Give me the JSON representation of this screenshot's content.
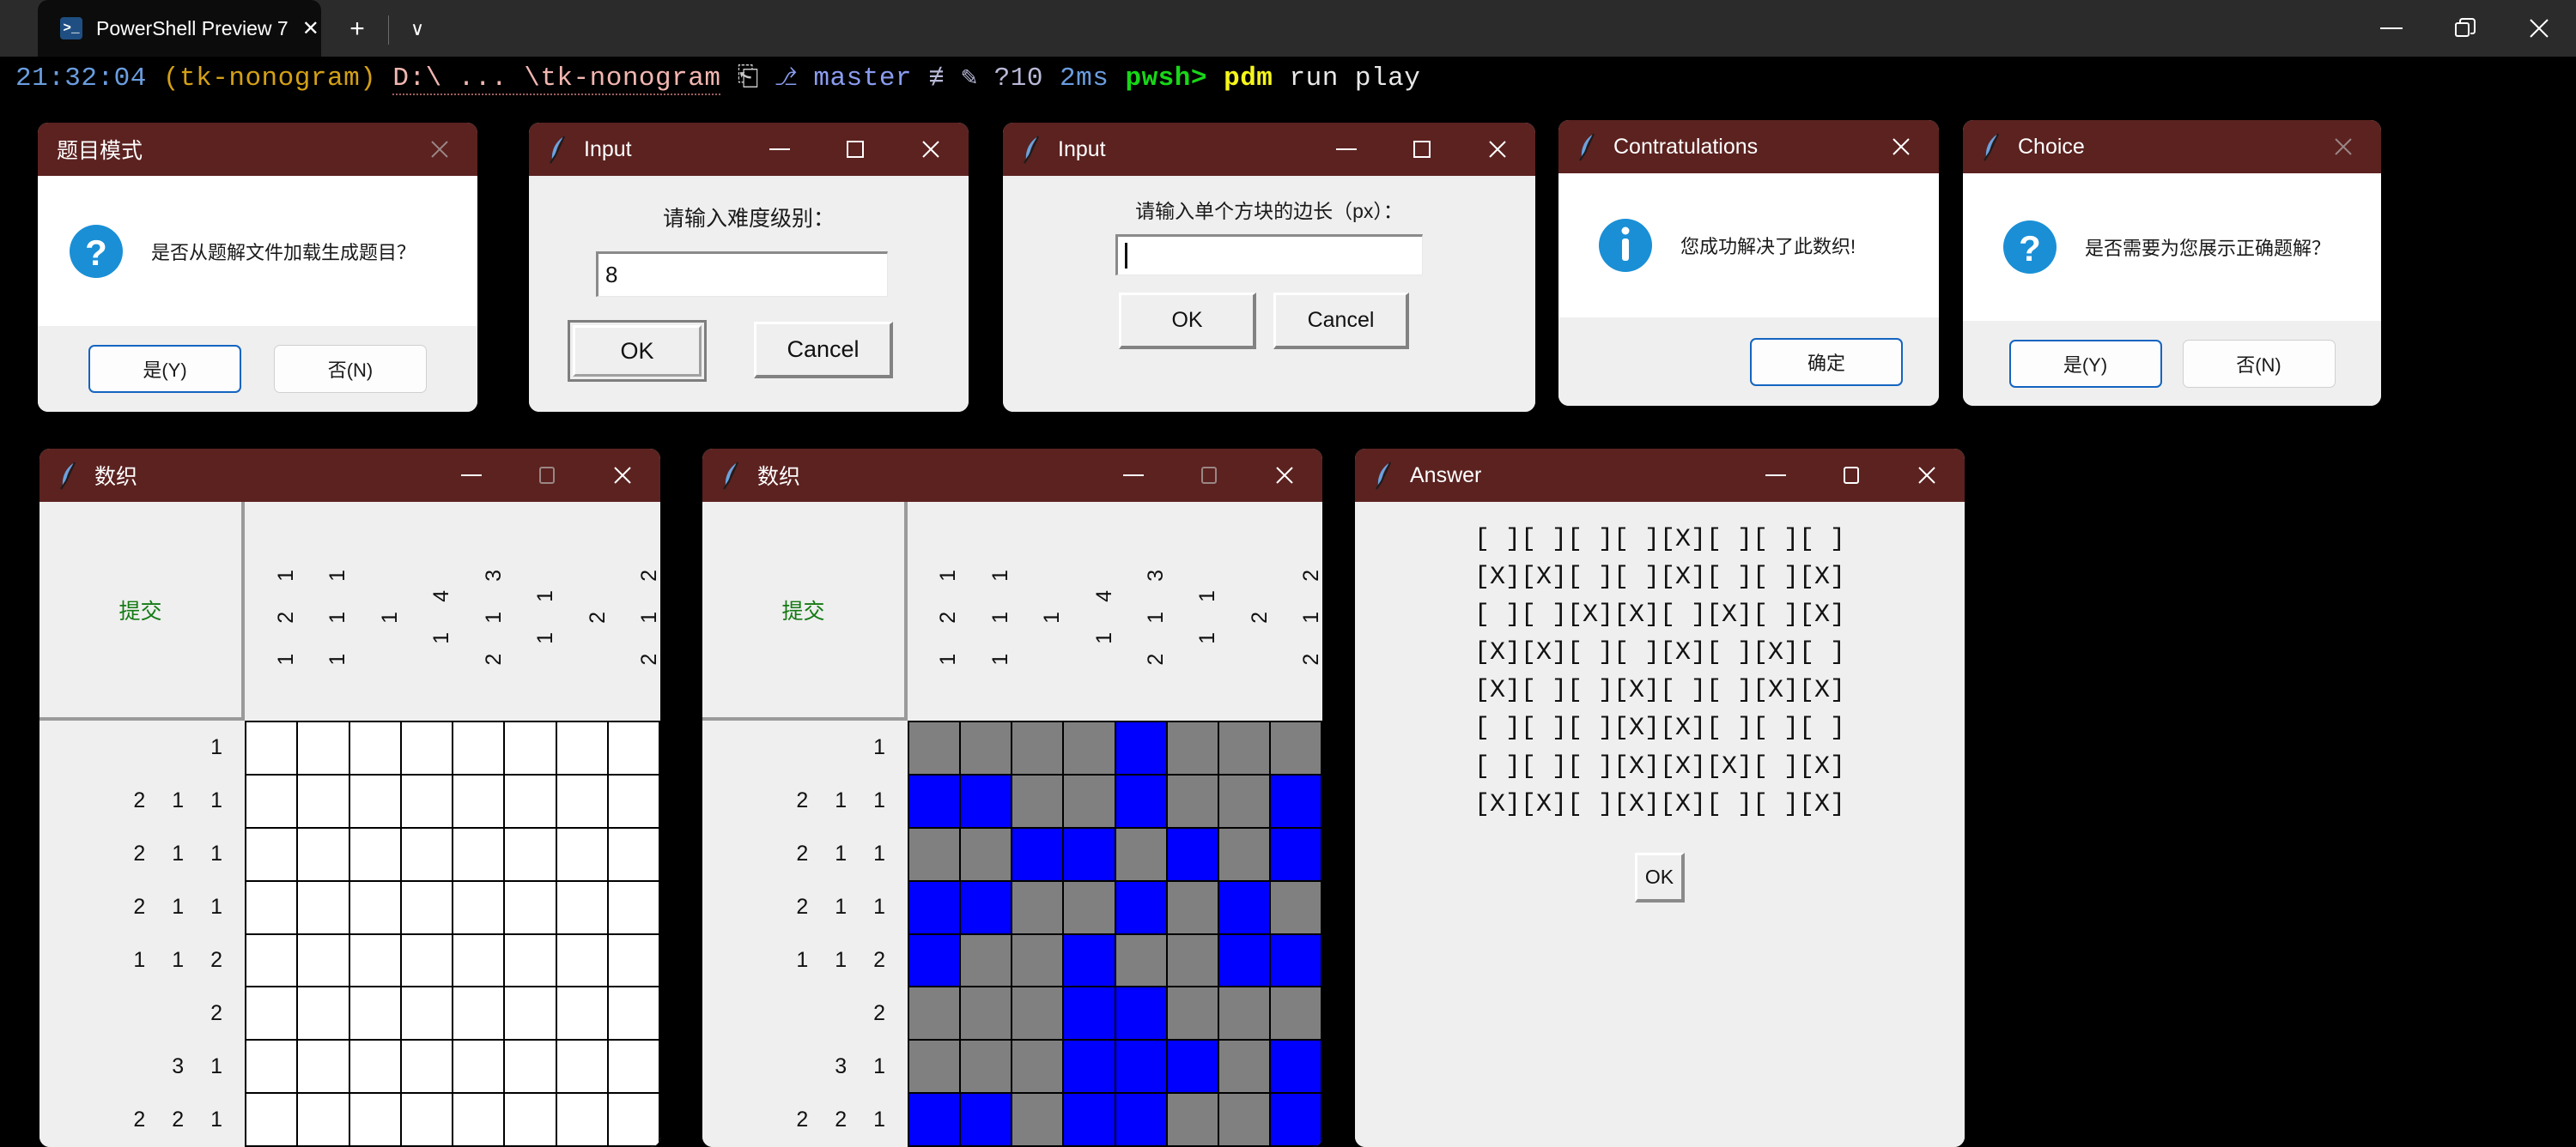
{
  "terminal": {
    "tab": {
      "title": "PowerShell Preview 7",
      "icon": "powershell-icon",
      "close_label": "✕"
    },
    "new_tab_label": "+",
    "dropdown_label": "∨",
    "window_controls": {
      "minimize": "minimize-icon",
      "restore": "restore-icon",
      "close": "close-icon"
    },
    "prompt": {
      "time": "21:32:04",
      "venv": "(tk-nonogram)",
      "path": "D:\\ ... \\tk-nonogram",
      "path_icon": "⎗",
      "git_icon": "⎇",
      "branch": "master",
      "git_status": "≢ ✎",
      "untracked": "?10",
      "duration": "2ms",
      "shell": "pwsh>",
      "command": "pdm",
      "args": "run play"
    }
  },
  "colors": {
    "titlebar": "#5b2220",
    "accent_blue": "#1464c0",
    "info_icon": "#1a8fd6",
    "cell_filled": "#0000ff",
    "cell_empty": "#808080",
    "submit_green": "#137a13",
    "prompt_green": "#18d718",
    "prompt_yellow": "#f6f61a"
  },
  "dialogs": {
    "question_mode": {
      "title": "题目模式",
      "close_label": "✕",
      "icon": "question-icon",
      "message": "是否从题解文件加载生成题目？",
      "yes_label": "是(Y)",
      "no_label": "否(N)"
    },
    "input_difficulty": {
      "title": "Input",
      "label": "请输入难度级别：",
      "value": "8",
      "ok_label": "OK",
      "cancel_label": "Cancel",
      "minimize": "minimize-icon",
      "maximize": "maximize-icon",
      "close": "close-icon"
    },
    "input_cellsize": {
      "title": "Input",
      "label": "请输入单个方块的边长（px）：",
      "value": "",
      "ok_label": "OK",
      "cancel_label": "Cancel",
      "minimize": "minimize-icon",
      "maximize": "maximize-icon",
      "close": "close-icon"
    },
    "congratulations": {
      "title": "Contratulations",
      "close_label": "✕",
      "icon": "info-icon",
      "message": "您成功解决了此数织!",
      "ok_label": "确定"
    },
    "choice": {
      "title": "Choice",
      "close_label": "✕",
      "icon": "question-icon",
      "message": "是否需要为您展示正确题解？",
      "yes_label": "是(Y)",
      "no_label": "否(N)"
    }
  },
  "nonogram": {
    "title": "数织",
    "submit_label": "提交",
    "minimize": "minimize-icon",
    "maximize": "maximize-icon",
    "close": "close-icon",
    "size": 8,
    "row_clues": [
      "1",
      "2 1 1",
      "2 1 1",
      "2 1 1",
      "1 1 2",
      "2",
      "3 1",
      "2 2 1"
    ],
    "col_clues": [
      "1 2 1",
      "1 1 1",
      "1",
      "1 4",
      "2 1 3",
      "1 1",
      "2",
      "2 1 2"
    ],
    "empty_solution": [
      [
        0,
        0,
        0,
        0,
        0,
        0,
        0,
        0
      ],
      [
        0,
        0,
        0,
        0,
        0,
        0,
        0,
        0
      ],
      [
        0,
        0,
        0,
        0,
        0,
        0,
        0,
        0
      ],
      [
        0,
        0,
        0,
        0,
        0,
        0,
        0,
        0
      ],
      [
        0,
        0,
        0,
        0,
        0,
        0,
        0,
        0
      ],
      [
        0,
        0,
        0,
        0,
        0,
        0,
        0,
        0
      ],
      [
        0,
        0,
        0,
        0,
        0,
        0,
        0,
        0
      ],
      [
        0,
        0,
        0,
        0,
        0,
        0,
        0,
        0
      ]
    ],
    "solution": [
      [
        0,
        0,
        0,
        0,
        1,
        0,
        0,
        0
      ],
      [
        1,
        1,
        0,
        0,
        1,
        0,
        0,
        1
      ],
      [
        0,
        0,
        1,
        1,
        0,
        1,
        0,
        1
      ],
      [
        1,
        1,
        0,
        0,
        1,
        0,
        1,
        0
      ],
      [
        1,
        0,
        0,
        1,
        0,
        0,
        1,
        1
      ],
      [
        0,
        0,
        0,
        1,
        1,
        0,
        0,
        0
      ],
      [
        0,
        0,
        0,
        1,
        1,
        1,
        0,
        1
      ],
      [
        1,
        1,
        0,
        1,
        1,
        0,
        0,
        1
      ]
    ]
  },
  "answer": {
    "title": "Answer",
    "minimize": "minimize-icon",
    "maximize": "maximize-icon",
    "close": "close-icon",
    "ok_label": "OK",
    "lines": [
      "[ ][ ][ ][ ][X][ ][ ][ ]",
      "[X][X][ ][ ][X][ ][ ][X]",
      "[ ][ ][X][X][ ][X][ ][X]",
      "[X][X][ ][ ][X][ ][X][ ]",
      "[X][ ][ ][X][ ][ ][X][X]",
      "[ ][ ][ ][X][X][ ][ ][ ]",
      "[ ][ ][ ][X][X][X][ ][X]",
      "[X][X][ ][X][X][ ][ ][X]"
    ]
  }
}
